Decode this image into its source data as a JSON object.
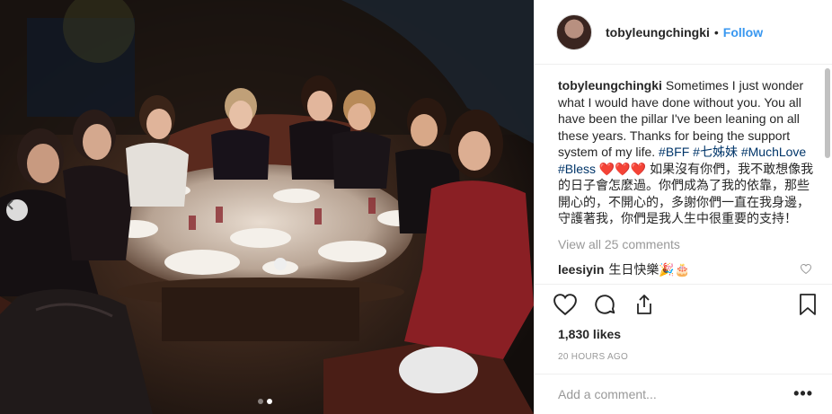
{
  "post": {
    "username": "tobyleungchingki",
    "separator": "•",
    "follow_label": "Follow"
  },
  "caption": {
    "username": "tobyleungchingki",
    "text_1": "Sometimes I just wonder what I would have done without you. You all have been the pillar I've been leaning on all these years. Thanks for being the support system of my life. ",
    "tag_bff": "#BFF",
    "tag_sisters": "#七姊妹",
    "tag_muchlove": "#MuchLove",
    "tag_bless": "#Bless",
    "hearts": "❤️❤️❤️",
    "text_2": "如果沒有你們，我不敢想像我的日子會怎麼過。你們成為了我的依靠，那些開心的，不開心的，多謝你們一直在我身邊，守護著我，你們是我人生中很重要的支持！"
  },
  "view_all": "View all 25 comments",
  "comment": {
    "username": "leesiyin",
    "text": "生日快樂🎉🎂"
  },
  "likes": "1,830 likes",
  "time": "20 HOURS AGO",
  "add_comment_placeholder": "Add a comment...",
  "more_label": "•••",
  "carousel": {
    "total": 2,
    "active": 2
  },
  "colors": {
    "link": "#3897f0",
    "hashtag": "#003569",
    "photo_bg": "#120d0b",
    "dress": "#8a1f24",
    "table": "#3a2519"
  },
  "icons": [
    "chevron-left-icon",
    "heart-icon",
    "comment-icon",
    "share-icon",
    "bookmark-icon",
    "more-icon"
  ]
}
